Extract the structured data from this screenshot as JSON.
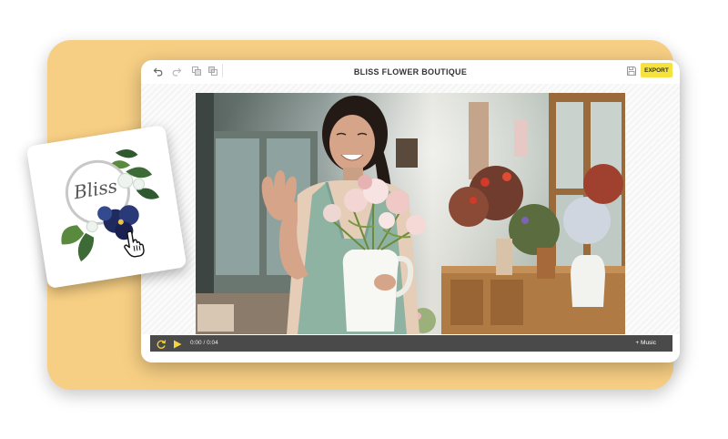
{
  "toolbar": {
    "undo_icon": "undo-icon",
    "redo_icon": "redo-icon",
    "layers_icon": "layers-icon",
    "duplicate_icon": "duplicate-icon",
    "save_icon": "save-icon",
    "export_label": "EXPORT"
  },
  "project": {
    "title": "BLISS FLOWER BOUTIQUE"
  },
  "player": {
    "time": "0:00 / 0:04",
    "music_label": "+ Music",
    "replay_icon": "replay-icon",
    "play_icon": "play-icon"
  },
  "logo": {
    "text": "Bliss",
    "cursor_icon": "hand-pointer-icon"
  },
  "colors": {
    "background_card": "#f7cf84",
    "export_button": "#f5e23c",
    "playbar": "#4a4a4a",
    "play_icon": "#f5d43c"
  }
}
